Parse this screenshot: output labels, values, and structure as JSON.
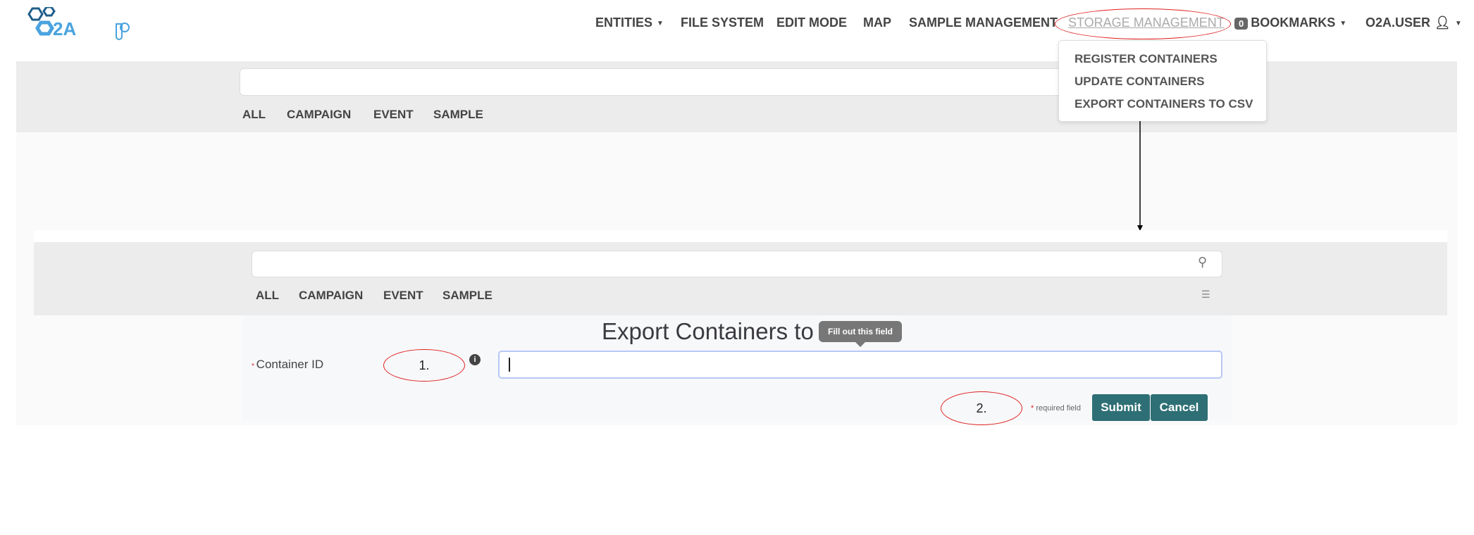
{
  "brand": {
    "logo_text": "O2A"
  },
  "nav": {
    "entities": "ENTITIES",
    "file_system": "FILE SYSTEM",
    "edit_mode": "EDIT MODE",
    "map": "MAP",
    "sample_management": "SAMPLE MANAGEMENT",
    "storage_management": "STORAGE MANAGEMENT",
    "bookmarks_count": "0",
    "bookmarks": "BOOKMARKS",
    "user": "O2A.USER"
  },
  "dropdown": {
    "items": [
      "REGISTER CONTAINERS",
      "UPDATE CONTAINERS",
      "EXPORT CONTAINERS TO CSV"
    ]
  },
  "tabs": [
    "ALL",
    "CAMPAIGN",
    "EVENT",
    "SAMPLE"
  ],
  "form": {
    "title": "Export Containers to",
    "tooltip": "Fill out this field",
    "field_label": "Container ID",
    "field_value": "",
    "required_note": "required field",
    "submit": "Submit",
    "cancel": "Cancel"
  },
  "annotations": {
    "step1": "1.",
    "step2": "2."
  },
  "colors": {
    "accent": "#2e6f75",
    "annotation": "#e02020",
    "logo": "#4aa3df"
  }
}
